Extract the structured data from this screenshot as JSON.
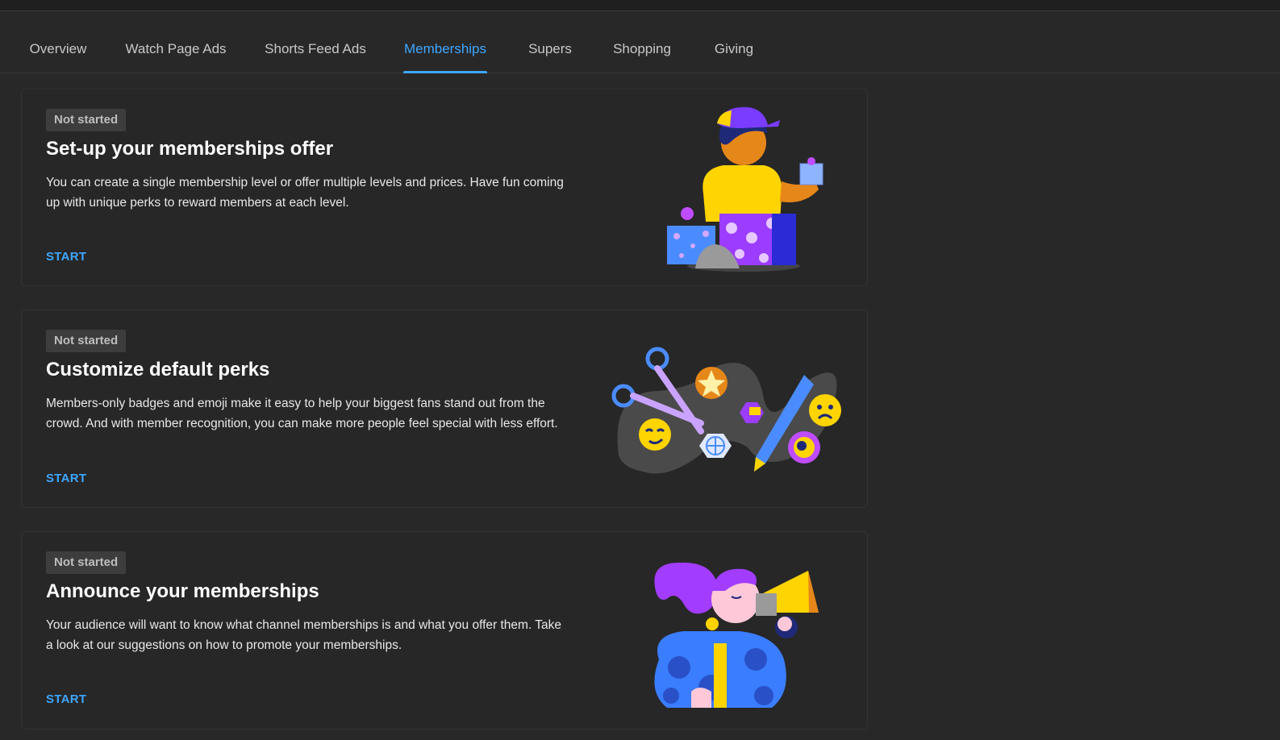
{
  "tabs": [
    {
      "label": "Overview"
    },
    {
      "label": "Watch Page Ads"
    },
    {
      "label": "Shorts Feed Ads"
    },
    {
      "label": "Memberships"
    },
    {
      "label": "Supers"
    },
    {
      "label": "Shopping"
    },
    {
      "label": "Giving"
    }
  ],
  "active_tab": "Memberships",
  "cards": [
    {
      "status": "Not started",
      "title": "Set-up your memberships offer",
      "description": "You can create a single membership level or offer multiple levels and prices. Have fun coming up with unique perks to reward members at each level.",
      "action": "START",
      "illustration": "person-wrapping-gifts"
    },
    {
      "status": "Not started",
      "title": "Customize default perks",
      "description": "Members-only badges and emoji make it easy to help your biggest fans stand out from the crowd. And with member recognition, you can make more people feel special with less effort.",
      "action": "START",
      "illustration": "scissors-pencil-badges-emoji"
    },
    {
      "status": "Not started",
      "title": "Announce your memberships",
      "description": "Your audience will want to know what channel memberships is and what you offer them. Take a look at our suggestions on how to promote your memberships.",
      "action": "START",
      "illustration": "person-with-megaphone"
    }
  ],
  "colors": {
    "background": "#282828",
    "accent": "#3ea6ff",
    "badge_bg": "#3d3d3d"
  }
}
